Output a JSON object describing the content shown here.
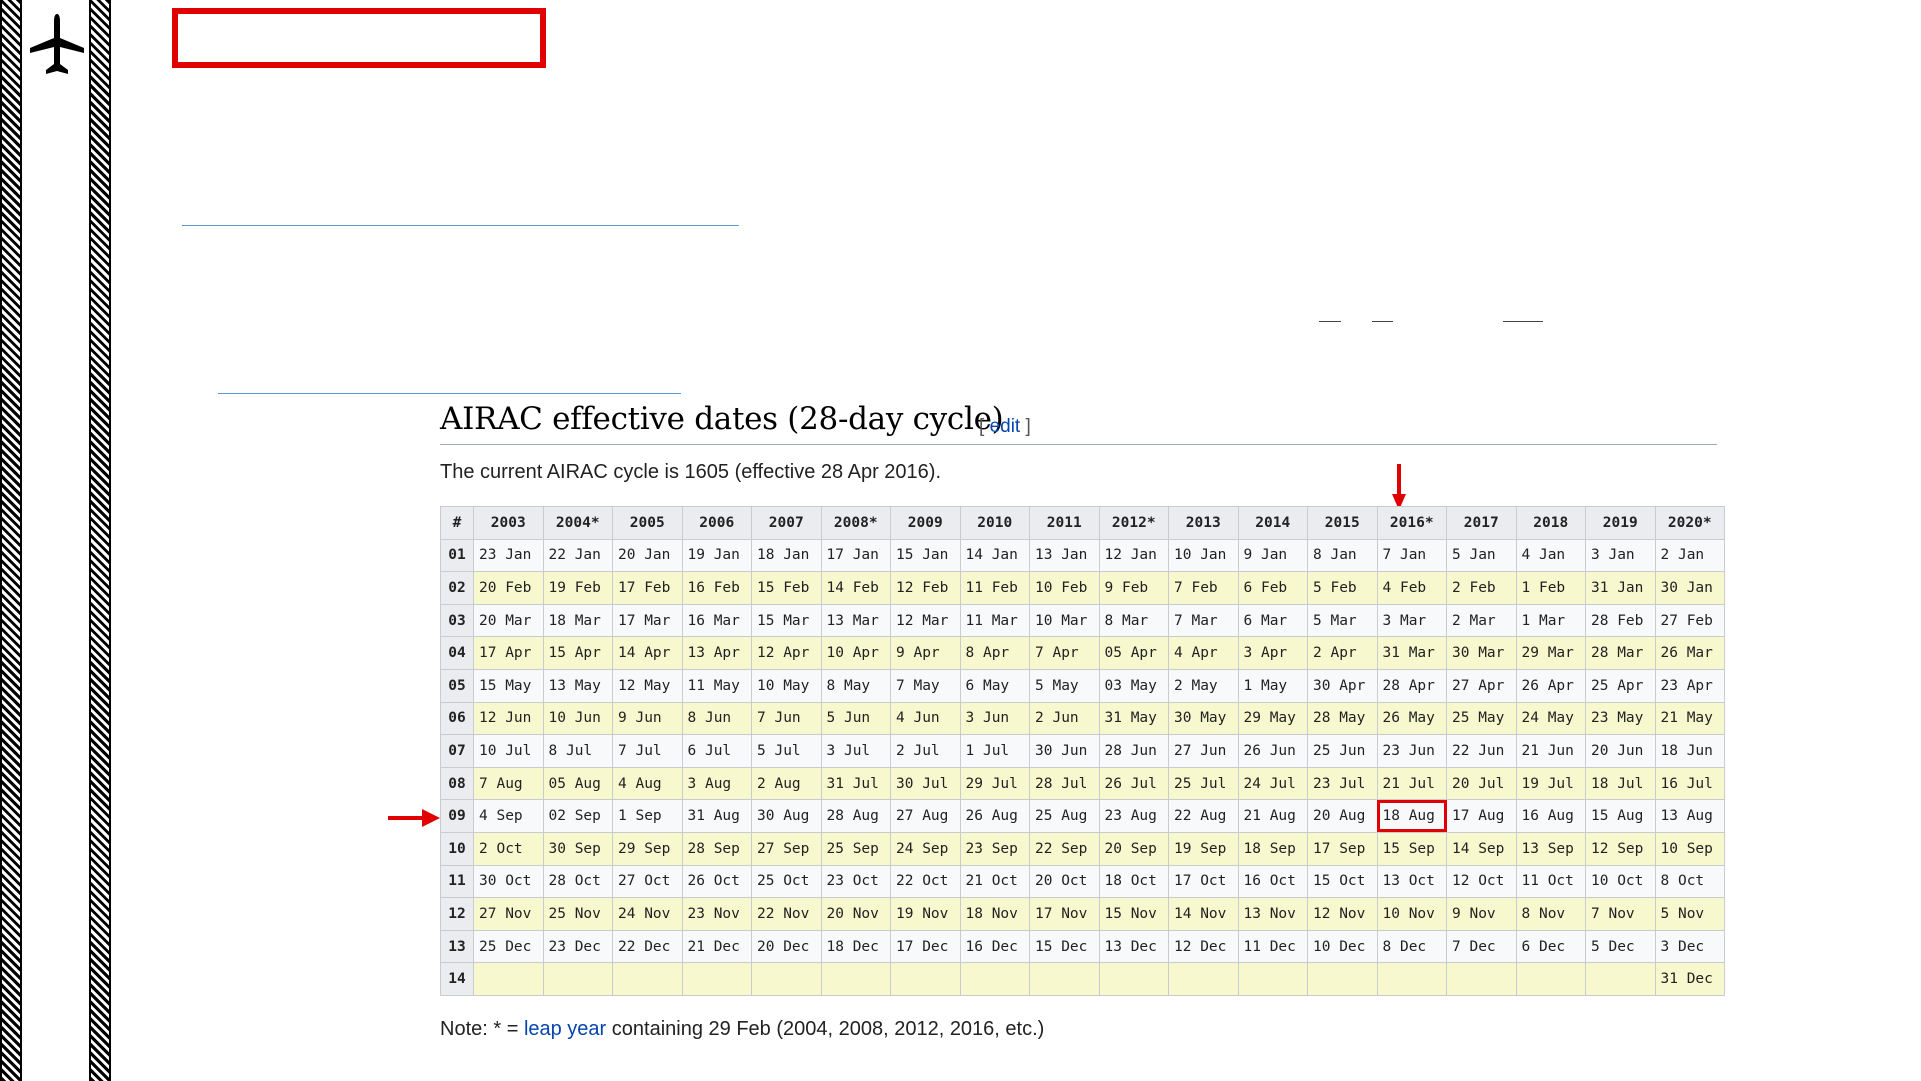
{
  "heading": "AIRAC effective dates (28-day cycle)",
  "edit": {
    "open": "[",
    "label": "edit",
    "close": "]"
  },
  "intro": "The current AIRAC cycle is 1605 (effective 28 Apr 2016).",
  "table": {
    "header_num": "#",
    "years": [
      "2003",
      "2004*",
      "2005",
      "2006",
      "2007",
      "2008*",
      "2009",
      "2010",
      "2011",
      "2012*",
      "2013",
      "2014",
      "2015",
      "2016*",
      "2017",
      "2018",
      "2019",
      "2020*"
    ],
    "rows": [
      {
        "num": "01",
        "cells": [
          "23 Jan",
          "22 Jan",
          "20 Jan",
          "19 Jan",
          "18 Jan",
          "17 Jan",
          "15 Jan",
          "14 Jan",
          "13 Jan",
          "12 Jan",
          "10 Jan",
          "9 Jan",
          "8 Jan",
          "7 Jan",
          "5 Jan",
          "4 Jan",
          "3 Jan",
          "2 Jan"
        ]
      },
      {
        "num": "02",
        "cells": [
          "20 Feb",
          "19 Feb",
          "17 Feb",
          "16 Feb",
          "15 Feb",
          "14 Feb",
          "12 Feb",
          "11 Feb",
          "10 Feb",
          "9 Feb",
          "7 Feb",
          "6 Feb",
          "5 Feb",
          "4 Feb",
          "2 Feb",
          "1 Feb",
          "31 Jan",
          "30 Jan"
        ]
      },
      {
        "num": "03",
        "cells": [
          "20 Mar",
          "18 Mar",
          "17 Mar",
          "16 Mar",
          "15 Mar",
          "13 Mar",
          "12 Mar",
          "11 Mar",
          "10 Mar",
          "8 Mar",
          "7 Mar",
          "6 Mar",
          "5 Mar",
          "3 Mar",
          "2 Mar",
          "1 Mar",
          "28 Feb",
          "27 Feb"
        ]
      },
      {
        "num": "04",
        "cells": [
          "17 Apr",
          "15 Apr",
          "14 Apr",
          "13 Apr",
          "12 Apr",
          "10 Apr",
          "9 Apr",
          "8 Apr",
          "7 Apr",
          "05 Apr",
          "4 Apr",
          "3 Apr",
          "2 Apr",
          "31 Mar",
          "30 Mar",
          "29 Mar",
          "28 Mar",
          "26 Mar"
        ]
      },
      {
        "num": "05",
        "cells": [
          "15 May",
          "13 May",
          "12 May",
          "11 May",
          "10 May",
          "8 May",
          "7 May",
          "6 May",
          "5 May",
          "03 May",
          "2 May",
          "1 May",
          "30 Apr",
          "28 Apr",
          "27 Apr",
          "26 Apr",
          "25 Apr",
          "23 Apr"
        ]
      },
      {
        "num": "06",
        "cells": [
          "12 Jun",
          "10 Jun",
          "9 Jun",
          "8 Jun",
          "7 Jun",
          "5 Jun",
          "4 Jun",
          "3 Jun",
          "2 Jun",
          "31 May",
          "30 May",
          "29 May",
          "28 May",
          "26 May",
          "25 May",
          "24 May",
          "23 May",
          "21 May"
        ]
      },
      {
        "num": "07",
        "cells": [
          "10 Jul",
          "8 Jul",
          "7 Jul",
          "6 Jul",
          "5 Jul",
          "3 Jul",
          "2 Jul",
          "1 Jul",
          "30 Jun",
          "28 Jun",
          "27 Jun",
          "26 Jun",
          "25 Jun",
          "23 Jun",
          "22 Jun",
          "21 Jun",
          "20 Jun",
          "18 Jun"
        ]
      },
      {
        "num": "08",
        "cells": [
          "7 Aug",
          "05 Aug",
          "4 Aug",
          "3 Aug",
          "2 Aug",
          "31 Jul",
          "30 Jul",
          "29 Jul",
          "28 Jul",
          "26 Jul",
          "25 Jul",
          "24 Jul",
          "23 Jul",
          "21 Jul",
          "20 Jul",
          "19 Jul",
          "18 Jul",
          "16 Jul"
        ]
      },
      {
        "num": "09",
        "cells": [
          "4 Sep",
          "02 Sep",
          "1 Sep",
          "31 Aug",
          "30 Aug",
          "28 Aug",
          "27 Aug",
          "26 Aug",
          "25 Aug",
          "23 Aug",
          "22 Aug",
          "21 Aug",
          "20 Aug",
          "18 Aug",
          "17 Aug",
          "16 Aug",
          "15 Aug",
          "13 Aug"
        ]
      },
      {
        "num": "10",
        "cells": [
          "2 Oct",
          "30 Sep",
          "29 Sep",
          "28 Sep",
          "27 Sep",
          "25 Sep",
          "24 Sep",
          "23 Sep",
          "22 Sep",
          "20 Sep",
          "19 Sep",
          "18 Sep",
          "17 Sep",
          "15 Sep",
          "14 Sep",
          "13 Sep",
          "12 Sep",
          "10 Sep"
        ]
      },
      {
        "num": "11",
        "cells": [
          "30 Oct",
          "28 Oct",
          "27 Oct",
          "26 Oct",
          "25 Oct",
          "23 Oct",
          "22 Oct",
          "21 Oct",
          "20 Oct",
          "18 Oct",
          "17 Oct",
          "16 Oct",
          "15 Oct",
          "13 Oct",
          "12 Oct",
          "11 Oct",
          "10 Oct",
          "8 Oct"
        ]
      },
      {
        "num": "12",
        "cells": [
          "27 Nov",
          "25 Nov",
          "24 Nov",
          "23 Nov",
          "22 Nov",
          "20 Nov",
          "19 Nov",
          "18 Nov",
          "17 Nov",
          "15 Nov",
          "14 Nov",
          "13 Nov",
          "12 Nov",
          "10 Nov",
          "9 Nov",
          "8 Nov",
          "7 Nov",
          "5 Nov"
        ]
      },
      {
        "num": "13",
        "cells": [
          "25 Dec",
          "23 Dec",
          "22 Dec",
          "21 Dec",
          "20 Dec",
          "18 Dec",
          "17 Dec",
          "16 Dec",
          "15 Dec",
          "13 Dec",
          "12 Dec",
          "11 Dec",
          "10 Dec",
          "8 Dec",
          "7 Dec",
          "6 Dec",
          "5 Dec",
          "3 Dec"
        ]
      },
      {
        "num": "14",
        "cells": [
          "",
          "",
          "",
          "",
          "",
          "",
          "",
          "",
          "",
          "",
          "",
          "",
          "",
          "",
          "",
          "",
          "",
          "31 Dec"
        ]
      }
    ],
    "highlight": {
      "row": "09",
      "year": "2016*"
    }
  },
  "note": {
    "prefix": "Note: * = ",
    "link": "leap year",
    "suffix": " containing 29 Feb (2004, 2008, 2012, 2016, etc.)"
  },
  "colors": {
    "highlight": "#e00000",
    "link": "#0645ad",
    "row_alt": "#f8f8cf",
    "row_base": "#f8f9fa",
    "header": "#eaecf0"
  },
  "icons": {
    "plane": "airplane-icon",
    "down_arrow": "arrow-down-icon",
    "right_arrow": "arrow-right-icon"
  }
}
